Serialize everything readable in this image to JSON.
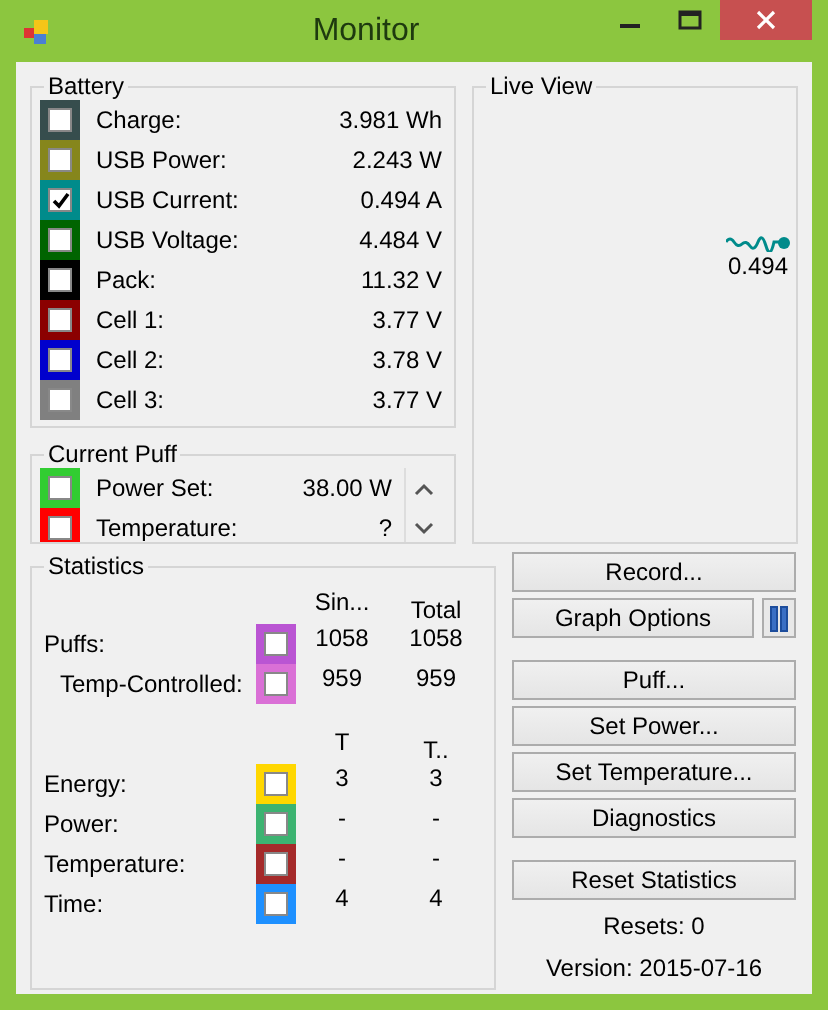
{
  "window": {
    "title": "Monitor"
  },
  "battery": {
    "title": "Battery",
    "items": [
      {
        "label": "Charge:",
        "value": "3.981 Wh",
        "color": "#364d4d",
        "checked": false
      },
      {
        "label": "USB Power:",
        "value": "2.243 W",
        "color": "#86861c",
        "checked": false
      },
      {
        "label": "USB Current:",
        "value": "0.494 A",
        "color": "#008b8b",
        "checked": true
      },
      {
        "label": "USB Voltage:",
        "value": "4.484 V",
        "color": "#006400",
        "checked": false
      },
      {
        "label": "Pack:",
        "value": "11.32 V",
        "color": "#000000",
        "checked": false
      },
      {
        "label": "Cell 1:",
        "value": "3.77 V",
        "color": "#8b0000",
        "checked": false
      },
      {
        "label": "Cell 2:",
        "value": "3.78 V",
        "color": "#0000cd",
        "checked": false
      },
      {
        "label": "Cell 3:",
        "value": "3.77 V",
        "color": "#808080",
        "checked": false
      }
    ]
  },
  "current_puff": {
    "title": "Current Puff",
    "items": [
      {
        "label": "Power Set:",
        "value": "38.00 W",
        "color": "#32cd32",
        "checked": false
      },
      {
        "label": "Temperature:",
        "value": "?",
        "color": "#ff0000",
        "checked": false
      }
    ]
  },
  "live_view": {
    "title": "Live View",
    "reading": "0.494"
  },
  "statistics": {
    "title": "Statistics",
    "columns": [
      "Sin...",
      "Total"
    ],
    "rows": [
      {
        "label": "Puffs:",
        "color": "#ba55d3",
        "checked": false,
        "values": [
          "1058",
          "1058"
        ]
      },
      {
        "label": "Temp-Controlled:",
        "color": "#da70d6",
        "checked": false,
        "values": [
          "959",
          "959"
        ]
      }
    ],
    "columns_2": [
      "T",
      "T.."
    ],
    "rows_2": [
      {
        "label": "Energy:",
        "color": "#ffd700",
        "checked": false,
        "values": [
          "3",
          "3"
        ]
      },
      {
        "label": "Power:",
        "color": "#3cb371",
        "checked": false,
        "values": [
          "-",
          "-"
        ]
      },
      {
        "label": "Temperature:",
        "color": "#a52a2a",
        "checked": false,
        "values": [
          "-",
          "-"
        ]
      },
      {
        "label": "Time:",
        "color": "#1e90ff",
        "checked": false,
        "values": [
          "4",
          "4"
        ]
      }
    ]
  },
  "button_groups": [
    [
      "Record...",
      "Graph Options"
    ],
    [
      "Puff...",
      "Set Power...",
      "Set Temperature...",
      "Diagnostics"
    ],
    [
      "Reset Statistics"
    ]
  ],
  "resets": "Resets: 0",
  "version": "Version: 2015-07-16"
}
